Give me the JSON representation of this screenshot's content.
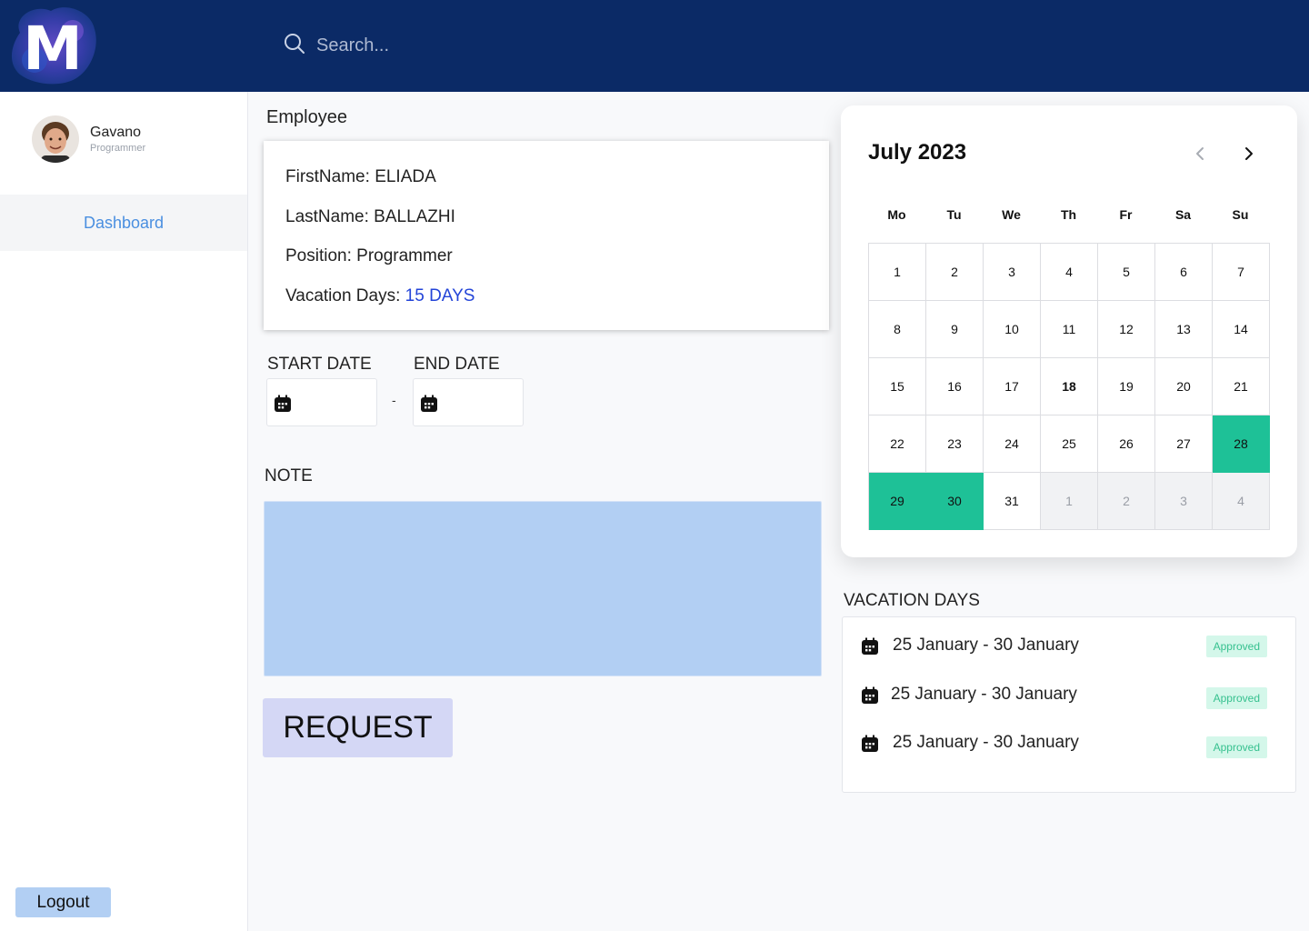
{
  "header": {
    "logo_text": "M",
    "search_placeholder": "Search..."
  },
  "sidebar": {
    "user": {
      "name": "Gavano",
      "role": "Programmer"
    },
    "nav": [
      {
        "label": "Dashboard"
      }
    ],
    "logout_label": "Logout"
  },
  "employee": {
    "title": "Employee",
    "first_name_label": "FirstName:",
    "first_name": "ELIADA",
    "last_name_label": "LastName:",
    "last_name": "BALLAZHI",
    "position_label": "Position:",
    "position": "Programmer",
    "vacation_label": "Vacation Days:",
    "vacation_value": "15 DAYS",
    "accent_color": "#2344d8"
  },
  "form": {
    "start_label": "START DATE",
    "end_label": "END DATE",
    "separator": "-",
    "note_label": "NOTE",
    "request_label": "REQUEST"
  },
  "calendar": {
    "title": "July 2023",
    "weekdays": [
      "Mo",
      "Tu",
      "We",
      "Th",
      "Fr",
      "Sa",
      "Su"
    ],
    "days": [
      {
        "d": "1"
      },
      {
        "d": "2"
      },
      {
        "d": "3"
      },
      {
        "d": "4"
      },
      {
        "d": "5"
      },
      {
        "d": "6"
      },
      {
        "d": "7"
      },
      {
        "d": "8"
      },
      {
        "d": "9"
      },
      {
        "d": "10"
      },
      {
        "d": "11"
      },
      {
        "d": "12"
      },
      {
        "d": "13"
      },
      {
        "d": "14"
      },
      {
        "d": "15"
      },
      {
        "d": "16"
      },
      {
        "d": "17"
      },
      {
        "d": "18",
        "today": true
      },
      {
        "d": "19"
      },
      {
        "d": "20"
      },
      {
        "d": "21"
      },
      {
        "d": "22"
      },
      {
        "d": "23"
      },
      {
        "d": "24"
      },
      {
        "d": "25"
      },
      {
        "d": "26"
      },
      {
        "d": "27"
      },
      {
        "d": "28",
        "selected": true
      },
      {
        "d": "29",
        "selected": true
      },
      {
        "d": "30",
        "selected": true
      },
      {
        "d": "31"
      },
      {
        "d": "1",
        "other": true
      },
      {
        "d": "2",
        "other": true
      },
      {
        "d": "3",
        "other": true
      },
      {
        "d": "4",
        "other": true
      }
    ],
    "selected_color": "#1ec197"
  },
  "vacation_days": {
    "title": "VACATION DAYS",
    "items": [
      {
        "range": "25 January - 30 January",
        "status": "Approved"
      },
      {
        "range": "25 January - 30 January",
        "status": "Approved"
      },
      {
        "range": "25 January - 30 January",
        "status": "Approved"
      }
    ],
    "status_color": "#36c18f"
  }
}
